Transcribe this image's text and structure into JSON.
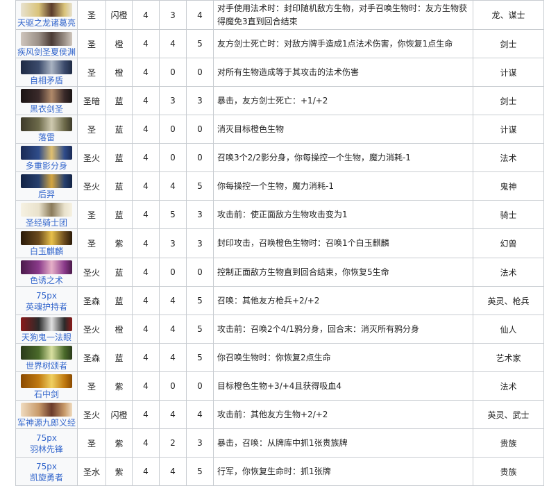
{
  "rows": [
    {
      "name": "天驱之龙诸葛亮",
      "thumb": "",
      "faction": "圣",
      "rarity": "闪橙",
      "cost": "4",
      "atk": "3",
      "hp": "4",
      "effect": "对手使用法术时：封印随机敌方生物，对手召唤生物时：友方生物获得魔免3直到回合结束",
      "tags": "龙、谋士",
      "colors": [
        "#d9c37a",
        "#5a3b2a",
        "#e8e2d0"
      ]
    },
    {
      "name": "疾风剑圣夏侯渊",
      "thumb": "",
      "faction": "圣",
      "rarity": "橙",
      "cost": "4",
      "atk": "4",
      "hp": "5",
      "effect": "友方剑士死亡时：对敌方牌手造成1点法术伤害，你恢复1点生命",
      "tags": "剑士",
      "colors": [
        "#9a8f86",
        "#4a3a34",
        "#cfc6bd"
      ]
    },
    {
      "name": "自相矛盾",
      "thumb": "",
      "faction": "圣",
      "rarity": "橙",
      "cost": "4",
      "atk": "0",
      "hp": "0",
      "effect": "对所有生物造成等于其攻击的法术伤害",
      "tags": "计谋",
      "colors": [
        "#3b4a6b",
        "#a9b3c2",
        "#1e2a44"
      ]
    },
    {
      "name": "黑衣剑圣",
      "thumb": "",
      "faction": "圣暗",
      "rarity": "蓝",
      "cost": "4",
      "atk": "3",
      "hp": "3",
      "effect": "暴击，友方剑士死亡：+1/+2",
      "tags": "剑士",
      "colors": [
        "#3a2a2a",
        "#b08a6a",
        "#1a1414"
      ]
    },
    {
      "name": "落雷",
      "thumb": "",
      "faction": "圣",
      "rarity": "蓝",
      "cost": "4",
      "atk": "0",
      "hp": "0",
      "effect": "消灭目标橙色生物",
      "tags": "计谋",
      "colors": [
        "#6d6a4a",
        "#cfcab0",
        "#3d3a2a"
      ]
    },
    {
      "name": "多重影分身",
      "thumb": "",
      "faction": "圣火",
      "rarity": "蓝",
      "cost": "4",
      "atk": "0",
      "hp": "0",
      "effect": "召唤3个2/2影分身，你每操控一个生物，魔力消耗-1",
      "tags": "法术",
      "colors": [
        "#2f4c8a",
        "#e0c070",
        "#1a2a55"
      ]
    },
    {
      "name": "后羿",
      "thumb": "",
      "faction": "圣火",
      "rarity": "蓝",
      "cost": "4",
      "atk": "4",
      "hp": "5",
      "effect": "你每操控一个生物，魔力消耗-1",
      "tags": "鬼神",
      "colors": [
        "#27406e",
        "#d4a640",
        "#122244"
      ]
    },
    {
      "name": "圣经骑士团",
      "thumb": "",
      "faction": "圣",
      "rarity": "蓝",
      "cost": "4",
      "atk": "5",
      "hp": "3",
      "effect": "攻击前：使正面敌方生物攻击变为1",
      "tags": "骑士",
      "colors": [
        "#e9e2cc",
        "#8a7a5a",
        "#f6f1e2"
      ]
    },
    {
      "name": "白玉麒麟",
      "thumb": "",
      "faction": "圣",
      "rarity": "紫",
      "cost": "4",
      "atk": "3",
      "hp": "3",
      "effect": "封印攻击，召唤橙色生物时：召唤1个白玉麒麟",
      "tags": "幻兽",
      "colors": [
        "#6a4a1e",
        "#e8c04a",
        "#2a1a08"
      ]
    },
    {
      "name": "色诱之术",
      "thumb": "",
      "faction": "圣火",
      "rarity": "蓝",
      "cost": "4",
      "atk": "0",
      "hp": "0",
      "effect": "控制正面敌方生物直到回合结束，你恢复5生命",
      "tags": "法术",
      "colors": [
        "#8a3a8a",
        "#e6b0c8",
        "#4a1a4a"
      ]
    },
    {
      "name": "英魂护持者",
      "thumb": "75px",
      "faction": "圣森",
      "rarity": "蓝",
      "cost": "4",
      "atk": "4",
      "hp": "5",
      "effect": "召唤：其他友方枪兵+2/+2",
      "tags": "英灵、枪兵",
      "colors": []
    },
    {
      "name": "天狗鬼一法眼",
      "thumb": "",
      "faction": "圣火",
      "rarity": "橙",
      "cost": "4",
      "atk": "4",
      "hp": "5",
      "effect": "攻击前：召唤2个4/1鸦分身，回合末：消灭所有鸦分身",
      "tags": "仙人",
      "colors": [
        "#2a2a2a",
        "#e0e0e0",
        "#8a1a1a"
      ]
    },
    {
      "name": "世界树颂者",
      "thumb": "",
      "faction": "圣森",
      "rarity": "蓝",
      "cost": "4",
      "atk": "4",
      "hp": "5",
      "effect": "你召唤生物时：你恢复2点生命",
      "tags": "艺术家",
      "colors": [
        "#4a6a2a",
        "#d8e0a0",
        "#2a3a1a"
      ]
    },
    {
      "name": "石中剑",
      "thumb": "",
      "faction": "圣",
      "rarity": "紫",
      "cost": "4",
      "atk": "0",
      "hp": "0",
      "effect": "目标橙色生物+3/+4且获得吸血4",
      "tags": "法术",
      "colors": [
        "#c07a10",
        "#f0d060",
        "#8a4a00"
      ]
    },
    {
      "name": "军神源九郎义经",
      "thumb": "",
      "faction": "圣火",
      "rarity": "闪橙",
      "cost": "4",
      "atk": "4",
      "hp": "4",
      "effect": "攻击前：其他友方生物+2/+2",
      "tags": "英灵、武士",
      "colors": [
        "#c89a6a",
        "#6a3a2a",
        "#f0dcc0"
      ]
    },
    {
      "name": "羽林先锋",
      "thumb": "75px",
      "faction": "圣",
      "rarity": "紫",
      "cost": "4",
      "atk": "2",
      "hp": "3",
      "effect": "暴击，召唤：从牌库中抓1张贵族牌",
      "tags": "贵族",
      "colors": []
    },
    {
      "name": "凯旋勇者",
      "thumb": "75px",
      "faction": "圣水",
      "rarity": "紫",
      "cost": "4",
      "atk": "4",
      "hp": "5",
      "effect": "行军，你恢复生命时：抓1张牌",
      "tags": "贵族",
      "colors": []
    }
  ]
}
